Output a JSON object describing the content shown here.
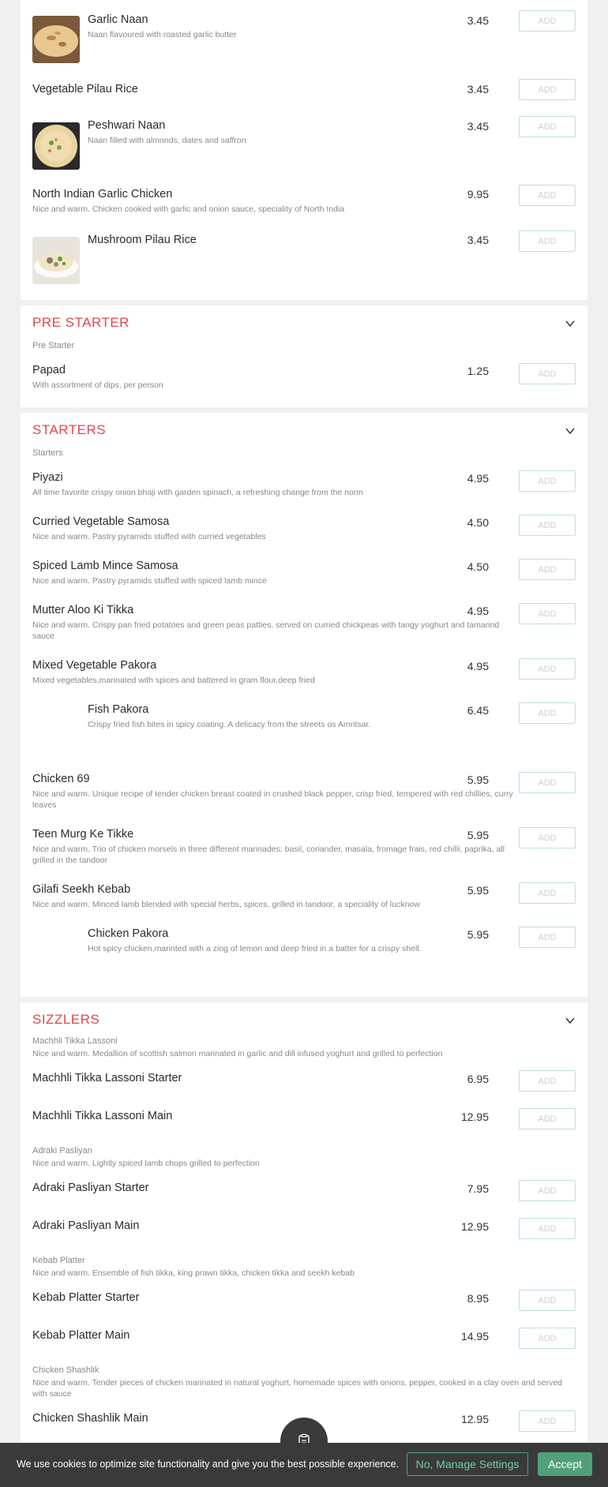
{
  "colors": {
    "accent": "#e0474c",
    "add_border": "#bfe0dc",
    "cookie_bg": "#3a3a3a",
    "accept_bg": "#52a07a"
  },
  "breads": {
    "items": [
      {
        "name": "Garlic Naan",
        "desc": "Naan flavoured with roasted garlic butter",
        "price": "3.45",
        "add": "ADD"
      },
      {
        "name": "Vegetable Pilau Rice",
        "desc": "",
        "price": "3.45",
        "add": "ADD"
      },
      {
        "name": "Peshwari Naan",
        "desc": "Naan filled with almonds, dates and saffron",
        "price": "3.45",
        "add": "ADD"
      },
      {
        "name": "North Indian Garlic Chicken",
        "desc": "Nice and warm. Chicken cooked with garlic and onion sauce, speciality of North India",
        "price": "9.95",
        "add": "ADD"
      },
      {
        "name": "Mushroom Pilau Rice",
        "desc": "",
        "price": "3.45",
        "add": "ADD"
      }
    ]
  },
  "pre_starter": {
    "title": "PRE STARTER",
    "subtitle": "Pre Starter",
    "items": [
      {
        "name": "Papad",
        "desc": "With assortment of dips, per person",
        "price": "1.25",
        "add": "ADD"
      }
    ]
  },
  "starters": {
    "title": "STARTERS",
    "subtitle": "Starters",
    "items": [
      {
        "name": "Piyazi",
        "desc": "All time favorite crispy onion bhaji with garden spinach, a refreshing change from the norm",
        "price": "4.95",
        "add": "ADD"
      },
      {
        "name": "Curried Vegetable Samosa",
        "desc": "Nice and warm. Pastry pyramids stuffed with curried vegetables",
        "price": "4.50",
        "add": "ADD"
      },
      {
        "name": "Spiced Lamb Mince Samosa",
        "desc": "Nice and warm. Pastry pyramids stuffed with spiced lamb mince",
        "price": "4.50",
        "add": "ADD"
      },
      {
        "name": "Mutter Aloo Ki Tikka",
        "desc": "Nice and warm. Crispy pan fried potatoes and green peas patties, served on curried chickpeas with tangy yoghurt and tamarind sauce",
        "price": "4.95",
        "add": "ADD"
      },
      {
        "name": "Mixed Vegetable Pakora",
        "desc": "Mixed vegetables,marinated with spices and battered in gram flour,deep fried",
        "price": "4.95",
        "add": "ADD"
      },
      {
        "name": "Fish Pakora",
        "desc": "Crispy fried fish bites in spicy coating. A delicacy from the streets os Amritsar.",
        "price": "6.45",
        "add": "ADD"
      },
      {
        "name": "Chicken 69",
        "desc": "Nice and warm. Unique recipe of tender chicken breast coated in crushed black pepper, crisp fried, tempered with red chillies, curry leaves",
        "price": "5.95",
        "add": "ADD"
      },
      {
        "name": "Teen Murg Ke Tikke",
        "desc": "Nice and warm. Trio of chicken morsels in three different marinades; basil, coriander, masala, fromage frais, red chilli, paprika, all grilled in the tandoor",
        "price": "5.95",
        "add": "ADD"
      },
      {
        "name": "Gilafi Seekh Kebab",
        "desc": "Nice and warm. Minced lamb blended with special herbs, spices, grilled in tandoor, a speciality of lucknow",
        "price": "5.95",
        "add": "ADD"
      },
      {
        "name": "Chicken Pakora",
        "desc": "Hot spicy chicken,marinted with a zing of lemon and deep fried in a batter for a crispy shell.",
        "price": "5.95",
        "add": "ADD"
      }
    ]
  },
  "sizzlers": {
    "title": "SIZZLERS",
    "groups": [
      {
        "name": "Machhli Tikka Lassoni",
        "desc": "Nice and warm. Medallion of scottish salmon marinated in garlic and dill infused yoghurt and grilled to perfection",
        "items": [
          {
            "name": "Machhli Tikka Lassoni Starter",
            "price": "6.95",
            "add": "ADD"
          },
          {
            "name": "Machhli Tikka Lassoni Main",
            "price": "12.95",
            "add": "ADD"
          }
        ]
      },
      {
        "name": "Adraki Pasliyan",
        "desc": "Nice and warm. Lightly spiced lamb chops grilled to perfection",
        "items": [
          {
            "name": "Adraki Pasliyan Starter",
            "price": "7.95",
            "add": "ADD"
          },
          {
            "name": "Adraki Pasliyan Main",
            "price": "12.95",
            "add": "ADD"
          }
        ]
      },
      {
        "name": "Kebab Platter",
        "desc": "Nice and warm. Ensemble of fish tikka, king prawn tikka, chicken tikka and seekh kebab",
        "items": [
          {
            "name": "Kebab Platter Starter",
            "price": "8.95",
            "add": "ADD"
          },
          {
            "name": "Kebab Platter Main",
            "price": "14.95",
            "add": "ADD"
          }
        ]
      },
      {
        "name": "Chicken Shashlik",
        "desc": "Nice and warm. Tender pieces of chicken marinated in natural yoghurt, homemade spices with onions, pepper, cooked in a clay oven and served with sauce",
        "items": [
          {
            "name": "Chicken Shashlik Main",
            "price": "12.95",
            "add": "ADD"
          }
        ]
      }
    ]
  },
  "cookie": {
    "text": "We use cookies to optimize site functionality and give you the best possible experience.",
    "manage_label": "No, Manage Settings",
    "accept_label": "Accept"
  },
  "fab": {
    "icon": "order-basket-icon"
  }
}
